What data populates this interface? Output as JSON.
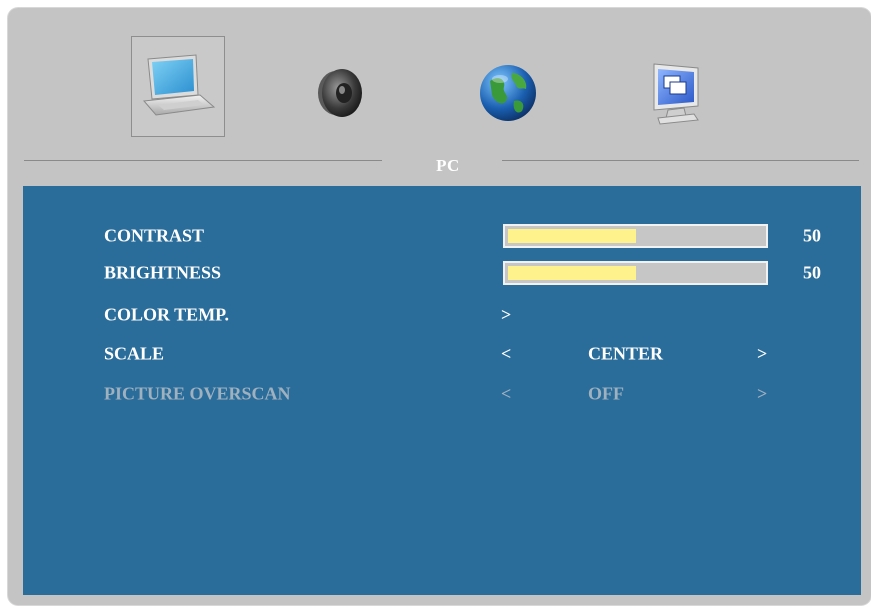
{
  "tabs": [
    {
      "name": "pc-tab",
      "icon": "laptop-icon",
      "selected": true
    },
    {
      "name": "audio-tab",
      "icon": "speaker-icon",
      "selected": false
    },
    {
      "name": "globe-tab",
      "icon": "globe-icon",
      "selected": false
    },
    {
      "name": "display-tab",
      "icon": "display-windows-icon",
      "selected": false
    }
  ],
  "section_title": "PC",
  "colors": {
    "panel_bg": "#c4c4c4",
    "menu_bg": "#2a6d9a",
    "bar_fill": "#fdf28c",
    "bar_track": "#c6c6c6",
    "text": "#ffffff",
    "text_disabled": "#9fb0bf"
  },
  "menu": {
    "contrast": {
      "label": "CONTRAST",
      "value": "50",
      "fill_fraction": 0.5
    },
    "brightness": {
      "label": "BRIGHTNESS",
      "value": "50",
      "fill_fraction": 0.5
    },
    "color_temp": {
      "label": "COLOR TEMP.",
      "arrow": ">"
    },
    "scale": {
      "label": "SCALE",
      "left_arrow": "<",
      "value": "CENTER",
      "right_arrow": ">"
    },
    "picture_overscan": {
      "label": "PICTURE OVERSCAN",
      "left_arrow": "<",
      "value": "OFF",
      "right_arrow": ">",
      "disabled": true
    }
  }
}
